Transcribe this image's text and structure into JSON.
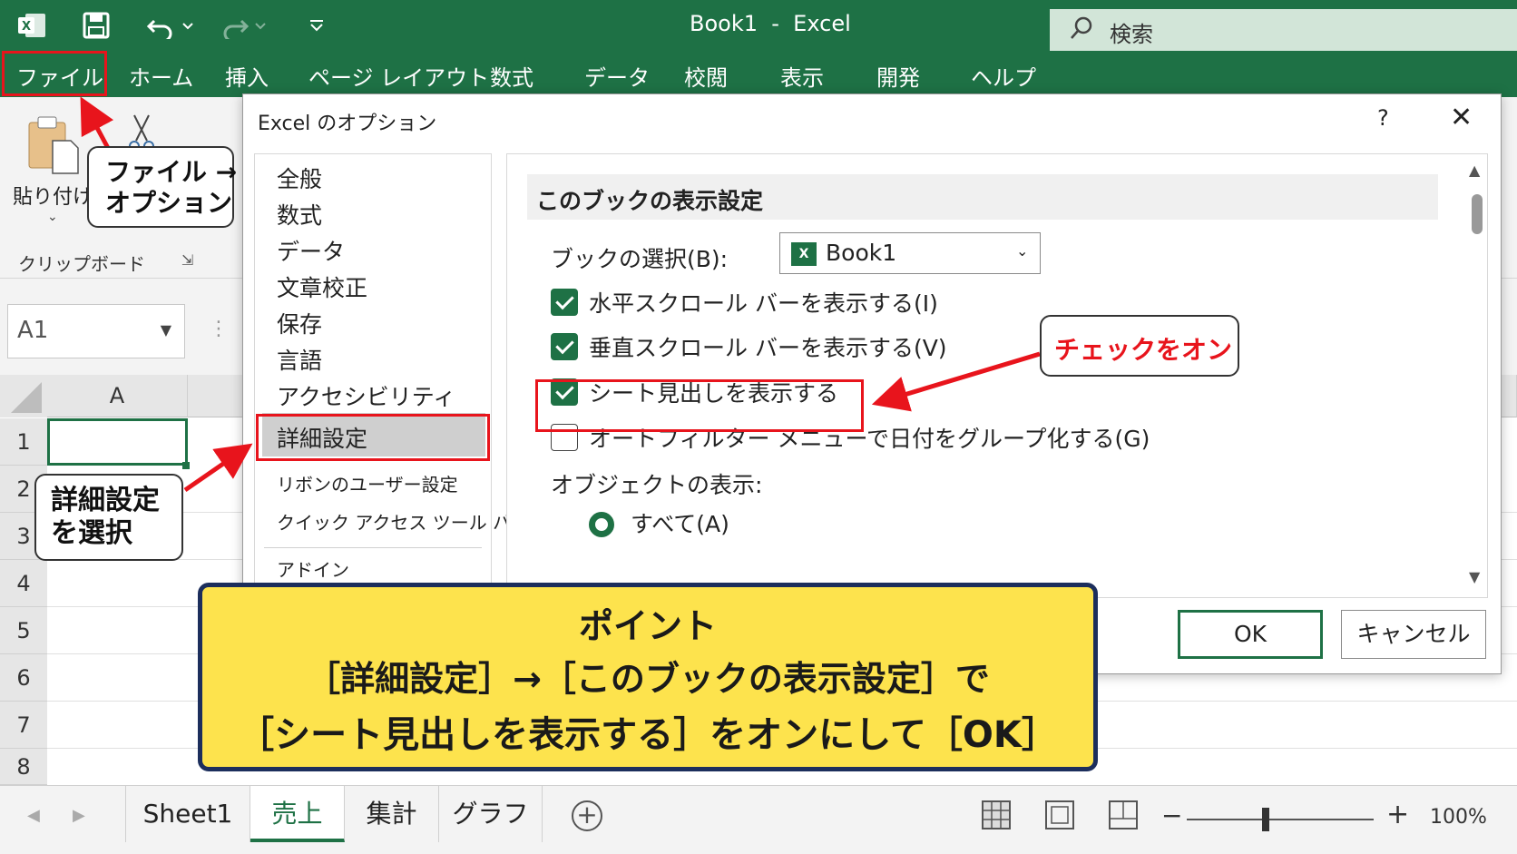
{
  "window": {
    "title": "Book1  -  Excel",
    "search_label": "検索",
    "accent_color": "#1e7145"
  },
  "menu": {
    "tabs": [
      "ファイル",
      "ホーム",
      "挿入",
      "ページ レイアウト",
      "数式",
      "データ",
      "校閲",
      "表示",
      "開発",
      "ヘルプ"
    ]
  },
  "ribbon": {
    "paste_label": "貼り付け",
    "clipboard_group": "クリップボード"
  },
  "namebox": {
    "value": "A1"
  },
  "grid": {
    "column": "A",
    "rows": [
      "1",
      "2",
      "3",
      "4",
      "5",
      "6",
      "7",
      "8"
    ]
  },
  "sheets": {
    "tabs": [
      "Sheet1",
      "売上",
      "集計",
      "グラフ"
    ],
    "active": "売上",
    "zoom": "100%"
  },
  "dialog": {
    "title": "Excel のオプション",
    "help": "?",
    "close": "✕",
    "nav": [
      "全般",
      "数式",
      "データ",
      "文章校正",
      "保存",
      "言語",
      "アクセシビリティ",
      "詳細設定",
      "リボンのユーザー設定",
      "クイック アクセス ツール バー",
      "アドイン"
    ],
    "selected_nav": "詳細設定",
    "section_title": "このブックの表示設定",
    "book_select_label": "ブックの選択(B):",
    "book_select_value": "Book1",
    "options": [
      {
        "label": "水平スクロール バーを表示する(I)",
        "checked": true
      },
      {
        "label": "垂直スクロール バーを表示する(V)",
        "checked": true
      },
      {
        "label": "シート見出しを表示する",
        "checked": true
      },
      {
        "label": "オートフィルター メニューで日付をグループ化する(G)",
        "checked": false
      }
    ],
    "objects_label": "オブジェクトの表示:",
    "radio_all": "すべて(A)",
    "ok": "OK",
    "cancel": "キャンセル"
  },
  "annotations": {
    "file_callout": [
      "ファイル →",
      "オプション"
    ],
    "detail_callout": [
      "詳細設定",
      "を選択"
    ],
    "check_callout": "チェックをオン",
    "highlight_color": "#e8141c",
    "point_title": "ポイント",
    "point_line1": "［詳細設定］→［このブックの表示設定］で",
    "point_line2": "［シート見出しを表示する］をオンにして［OK］"
  }
}
